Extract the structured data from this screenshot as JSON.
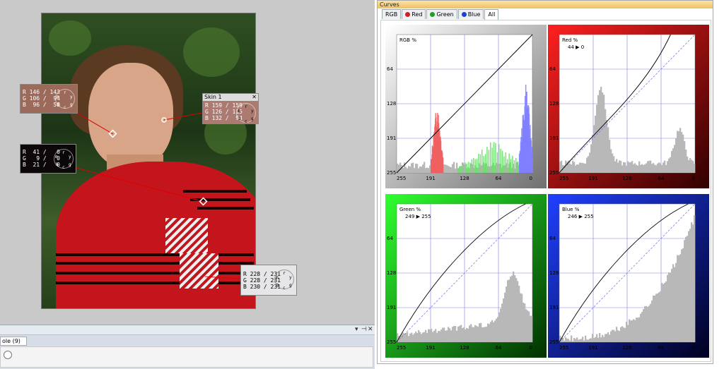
{
  "probes": {
    "face": {
      "title": "",
      "r": "R 146 / 143",
      "g": "G 106 /  94",
      "b": "B  96 /  58",
      "color": "#9c6a5a"
    },
    "skin": {
      "title": "Skin 1",
      "r": "R 159 / 159",
      "g": "G 126 / 115",
      "b": "B 132 /  94",
      "color": "#ab7a70"
    },
    "dark": {
      "title": "",
      "r": "R  41 /   0",
      "g": "G   9 /   0",
      "b": "B  21 /   0",
      "color": "#0c0708"
    },
    "white": {
      "title": "",
      "r": "R 228 / 231",
      "g": "G 228 / 231",
      "b": "B 230 / 231",
      "color": "#e6e6e8"
    },
    "close_glyph": "✕",
    "dial_letters": {
      "r": "r",
      "y": "y",
      "g": "g",
      "c": "c",
      "b": "b",
      "m": "m"
    }
  },
  "dock": {
    "tab_label": "ole (9)",
    "pin_glyph": "⊣",
    "close_glyph": "✕",
    "menu_glyph": "▾"
  },
  "curves": {
    "title": "Curves",
    "tabs": [
      {
        "label": "RGB",
        "dot": ""
      },
      {
        "label": "Red",
        "dot": "#d02020"
      },
      {
        "label": "Green",
        "dot": "#20a020"
      },
      {
        "label": "Blue",
        "dot": "#2040d0"
      },
      {
        "label": "All",
        "dot": "",
        "active": true
      }
    ],
    "panels": {
      "rgb": {
        "label": "RGB %",
        "readout": ""
      },
      "red": {
        "label": "Red %",
        "readout": "44 ▶ 0"
      },
      "green": {
        "label": "Green %",
        "readout": "249 ▶ 255"
      },
      "blue": {
        "label": "Blue %",
        "readout": "246 ▶ 255"
      }
    },
    "y_ticks": [
      "64",
      "128",
      "191",
      "255"
    ],
    "x_ticks": [
      "255",
      "191",
      "128",
      "64",
      "0"
    ],
    "colors": {
      "rgb_frame": "#7a7a7a",
      "red_frame": "#c01010",
      "green_frame": "#18b018",
      "blue_frame": "#1030b0",
      "grid": "#8080e0",
      "hist": "#b8b8b8"
    }
  }
}
